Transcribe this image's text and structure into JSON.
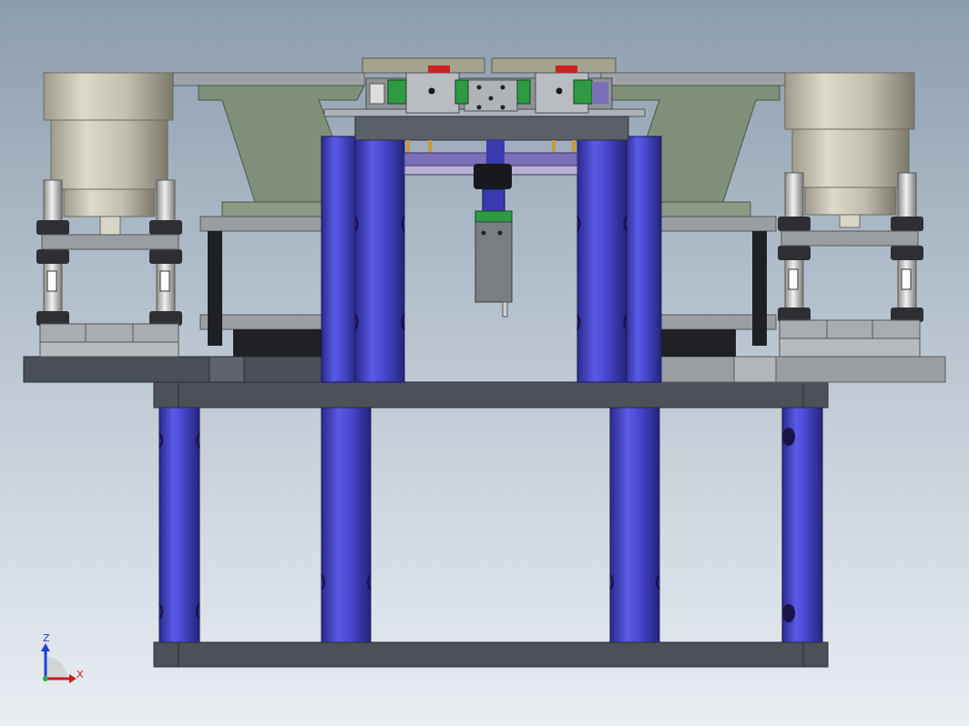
{
  "window": {
    "title": ""
  },
  "triad": {
    "z_label": "Z",
    "x_label": "X",
    "z_color": "#1f3fd6",
    "x_color": "#d01818",
    "origin_color": "#2fa84a",
    "view_orientation": "front"
  },
  "colors": {
    "background_top": "#8c9dae",
    "background_bottom": "#eaeef3",
    "column_blue": "#4848d2",
    "plate_dark": "#4a4e57",
    "plate_gray": "#9a9ea3",
    "bracket_green": "#7f8f7a",
    "motor_beige": "#c8c4b6",
    "accent_red": "#cc2222",
    "accent_green": "#2e9a44"
  }
}
